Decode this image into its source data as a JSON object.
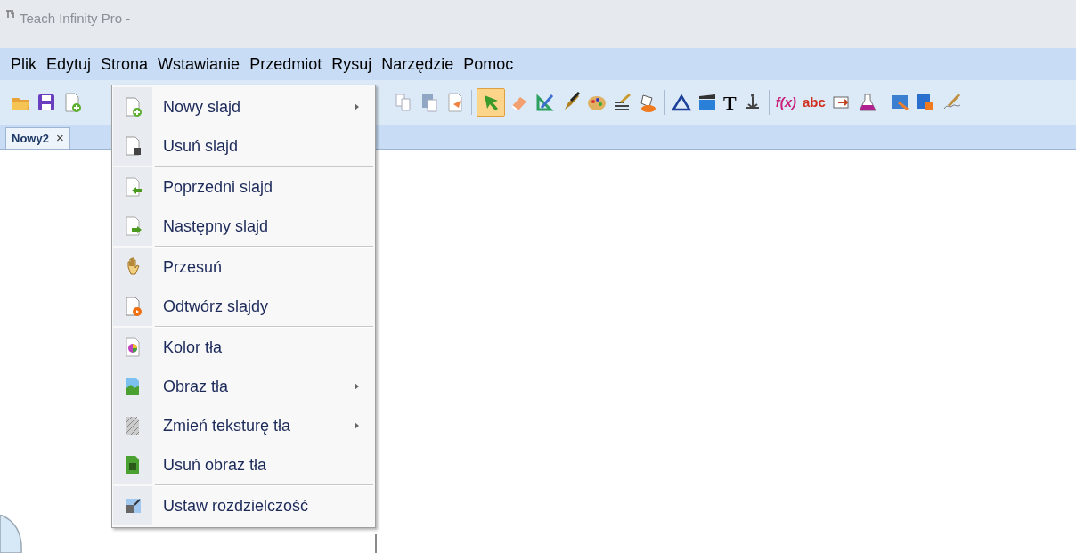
{
  "window": {
    "title": "Teach Infinity Pro -"
  },
  "menubar": [
    {
      "label": "Plik"
    },
    {
      "label": "Edytuj"
    },
    {
      "label": "Strona"
    },
    {
      "label": "Wstawianie"
    },
    {
      "label": "Przedmiot"
    },
    {
      "label": "Rysuj"
    },
    {
      "label": "Narzędzie"
    },
    {
      "label": "Pomoc"
    }
  ],
  "toolbar": {
    "groups": [
      [
        {
          "kind": "icon",
          "selected": false
        },
        {
          "kind": "icon",
          "selected": false
        },
        {
          "kind": "icon",
          "selected": false
        }
      ],
      [
        {
          "kind": "icon",
          "selected": false
        },
        {
          "kind": "icon",
          "selected": false
        },
        {
          "kind": "icon",
          "selected": false
        }
      ],
      [
        {
          "kind": "icon",
          "selected": true
        },
        {
          "kind": "icon",
          "selected": false
        },
        {
          "kind": "icon",
          "selected": false
        },
        {
          "kind": "icon",
          "selected": false
        },
        {
          "kind": "icon",
          "selected": false
        },
        {
          "kind": "icon",
          "selected": false
        },
        {
          "kind": "icon",
          "selected": false
        }
      ],
      [
        {
          "kind": "icon",
          "selected": false
        },
        {
          "kind": "icon",
          "selected": false
        },
        {
          "kind": "text",
          "label": "T",
          "selected": false
        },
        {
          "kind": "icon",
          "selected": false
        }
      ],
      [
        {
          "kind": "text",
          "label": "f(x)",
          "selected": false
        },
        {
          "kind": "text",
          "label": "abc",
          "selected": false
        },
        {
          "kind": "icon",
          "selected": false
        },
        {
          "kind": "icon",
          "selected": false
        }
      ],
      [
        {
          "kind": "icon",
          "selected": false
        },
        {
          "kind": "icon",
          "selected": false
        },
        {
          "kind": "icon",
          "selected": false
        }
      ]
    ]
  },
  "tabs": [
    {
      "label": "Nowy2",
      "close": "×",
      "selected": true
    }
  ],
  "menu": {
    "sections": [
      [
        {
          "label": "Nowy slajd",
          "submenu": true
        },
        {
          "label": "Usuń slajd",
          "submenu": false
        }
      ],
      [
        {
          "label": "Poprzedni slajd",
          "submenu": false
        },
        {
          "label": "Następny slajd",
          "submenu": false
        }
      ],
      [
        {
          "label": "Przesuń",
          "submenu": false
        },
        {
          "label": "Odtwórz slajdy",
          "submenu": false
        }
      ],
      [
        {
          "label": "Kolor tła",
          "submenu": false
        },
        {
          "label": "Obraz tła",
          "submenu": true
        },
        {
          "label": "Zmień teksturę tła",
          "submenu": true
        },
        {
          "label": "Usuń obraz tła",
          "submenu": false
        }
      ],
      [
        {
          "label": "Ustaw rozdzielczość",
          "submenu": false
        }
      ]
    ]
  }
}
